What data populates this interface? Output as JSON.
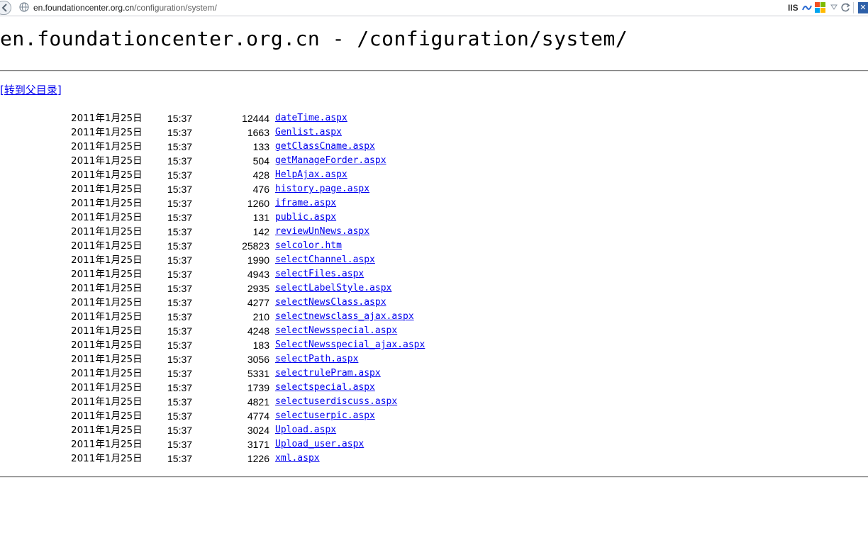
{
  "browser": {
    "url_host": "en.foundationcenter.org.cn",
    "url_path": "/configuration/system/",
    "iis_label": "IIS"
  },
  "page": {
    "title": "en.foundationcenter.org.cn - /configuration/system/",
    "parent_link": "[转到父目录]"
  },
  "files": [
    {
      "date": "2011年1月25日",
      "time": "15:37",
      "size": "12444",
      "name": "dateTime.aspx"
    },
    {
      "date": "2011年1月25日",
      "time": "15:37",
      "size": "1663",
      "name": "Genlist.aspx"
    },
    {
      "date": "2011年1月25日",
      "time": "15:37",
      "size": "133",
      "name": "getClassCname.aspx"
    },
    {
      "date": "2011年1月25日",
      "time": "15:37",
      "size": "504",
      "name": "getManageForder.aspx"
    },
    {
      "date": "2011年1月25日",
      "time": "15:37",
      "size": "428",
      "name": "HelpAjax.aspx"
    },
    {
      "date": "2011年1月25日",
      "time": "15:37",
      "size": "476",
      "name": "history.page.aspx"
    },
    {
      "date": "2011年1月25日",
      "time": "15:37",
      "size": "1260",
      "name": "iframe.aspx"
    },
    {
      "date": "2011年1月25日",
      "time": "15:37",
      "size": "131",
      "name": "public.aspx"
    },
    {
      "date": "2011年1月25日",
      "time": "15:37",
      "size": "142",
      "name": "reviewUnNews.aspx"
    },
    {
      "date": "2011年1月25日",
      "time": "15:37",
      "size": "25823",
      "name": "selcolor.htm"
    },
    {
      "date": "2011年1月25日",
      "time": "15:37",
      "size": "1990",
      "name": "selectChannel.aspx"
    },
    {
      "date": "2011年1月25日",
      "time": "15:37",
      "size": "4943",
      "name": "selectFiles.aspx"
    },
    {
      "date": "2011年1月25日",
      "time": "15:37",
      "size": "2935",
      "name": "selectLabelStyle.aspx"
    },
    {
      "date": "2011年1月25日",
      "time": "15:37",
      "size": "4277",
      "name": "selectNewsClass.aspx"
    },
    {
      "date": "2011年1月25日",
      "time": "15:37",
      "size": "210",
      "name": "selectnewsclass_ajax.aspx"
    },
    {
      "date": "2011年1月25日",
      "time": "15:37",
      "size": "4248",
      "name": "selectNewsspecial.aspx"
    },
    {
      "date": "2011年1月25日",
      "time": "15:37",
      "size": "183",
      "name": "SelectNewsspecial_ajax.aspx"
    },
    {
      "date": "2011年1月25日",
      "time": "15:37",
      "size": "3056",
      "name": "selectPath.aspx"
    },
    {
      "date": "2011年1月25日",
      "time": "15:37",
      "size": "5331",
      "name": "selectrulePram.aspx"
    },
    {
      "date": "2011年1月25日",
      "time": "15:37",
      "size": "1739",
      "name": "selectspecial.aspx"
    },
    {
      "date": "2011年1月25日",
      "time": "15:37",
      "size": "4821",
      "name": "selectuserdiscuss.aspx"
    },
    {
      "date": "2011年1月25日",
      "time": "15:37",
      "size": "4774",
      "name": "selectuserpic.aspx"
    },
    {
      "date": "2011年1月25日",
      "time": "15:37",
      "size": "3024",
      "name": "Upload.aspx"
    },
    {
      "date": "2011年1月25日",
      "time": "15:37",
      "size": "3171",
      "name": "Upload_user.aspx"
    },
    {
      "date": "2011年1月25日",
      "time": "15:37",
      "size": "1226",
      "name": "xml.aspx"
    }
  ]
}
